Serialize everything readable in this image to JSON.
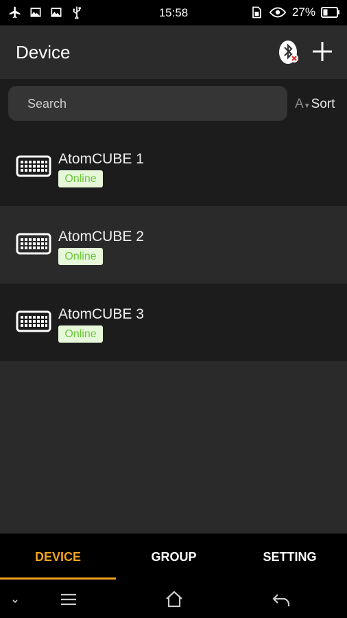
{
  "status_bar": {
    "time": "15:58",
    "battery_percent": "27%",
    "icons_left": [
      "airplane-icon",
      "image-icon",
      "image-icon",
      "usb-icon"
    ],
    "icons_right": [
      "sim-icon",
      "eye-icon",
      "battery-icon"
    ]
  },
  "app_bar": {
    "title": "Device",
    "bluetooth_icon": "bluetooth-disabled-icon",
    "add_icon": "plus-icon"
  },
  "search": {
    "placeholder": "Search",
    "sort_prefix": "A",
    "sort_label": "Sort"
  },
  "devices": [
    {
      "name": "AtomCUBE 1",
      "status": "Online"
    },
    {
      "name": "AtomCUBE 2",
      "status": "Online"
    },
    {
      "name": "AtomCUBE 3",
      "status": "Online"
    }
  ],
  "tabs": [
    {
      "label": "DEVICE",
      "active": true
    },
    {
      "label": "GROUP",
      "active": false
    },
    {
      "label": "SETTING",
      "active": false
    }
  ],
  "nav_bar": {
    "icons": [
      "chevron-down-icon",
      "menu-icon",
      "home-icon",
      "back-icon"
    ]
  },
  "colors": {
    "accent": "#f2a31b",
    "online_text": "#6bc63a",
    "online_bg": "#e6f7da"
  }
}
